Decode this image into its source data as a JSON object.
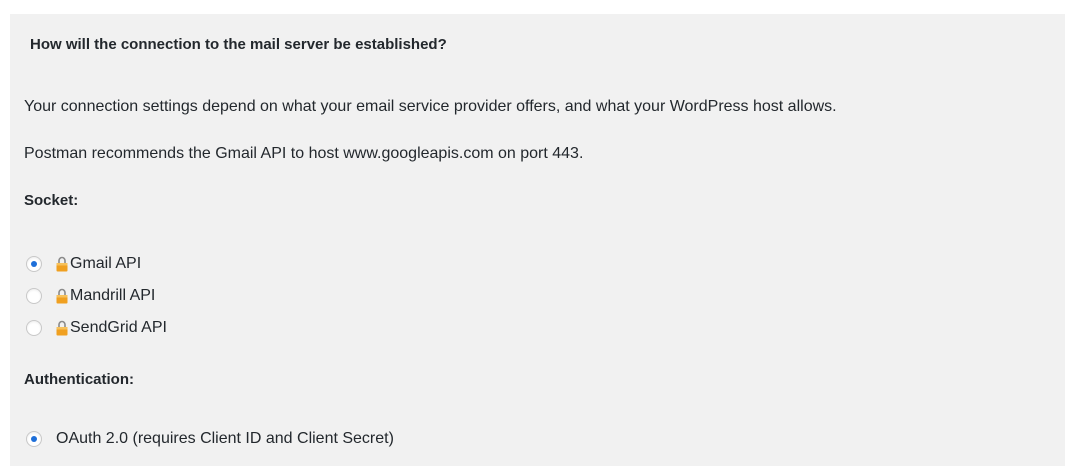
{
  "section": {
    "heading": "How will the connection to the mail server be established?",
    "intro": "Your connection settings depend on what your email service provider offers, and what your WordPress host allows.",
    "recommendation": "Postman recommends the Gmail API to host www.googleapis.com on port 443."
  },
  "socket": {
    "label": "Socket:",
    "selected": "Gmail API",
    "options": [
      {
        "label": "Gmail API",
        "checked": true,
        "icon": "lock-icon"
      },
      {
        "label": "Mandrill API",
        "checked": false,
        "icon": "lock-icon"
      },
      {
        "label": "SendGrid API",
        "checked": false,
        "icon": "lock-icon"
      }
    ]
  },
  "authentication": {
    "label": "Authentication:",
    "options": [
      {
        "label": "OAuth 2.0 (requires Client ID and Client Secret)",
        "checked": true
      }
    ]
  },
  "colors": {
    "panel_background": "#f1f1f1",
    "radio_dot": "#1e6fd9",
    "lock_body": "#f0a020",
    "text": "#23282d"
  }
}
